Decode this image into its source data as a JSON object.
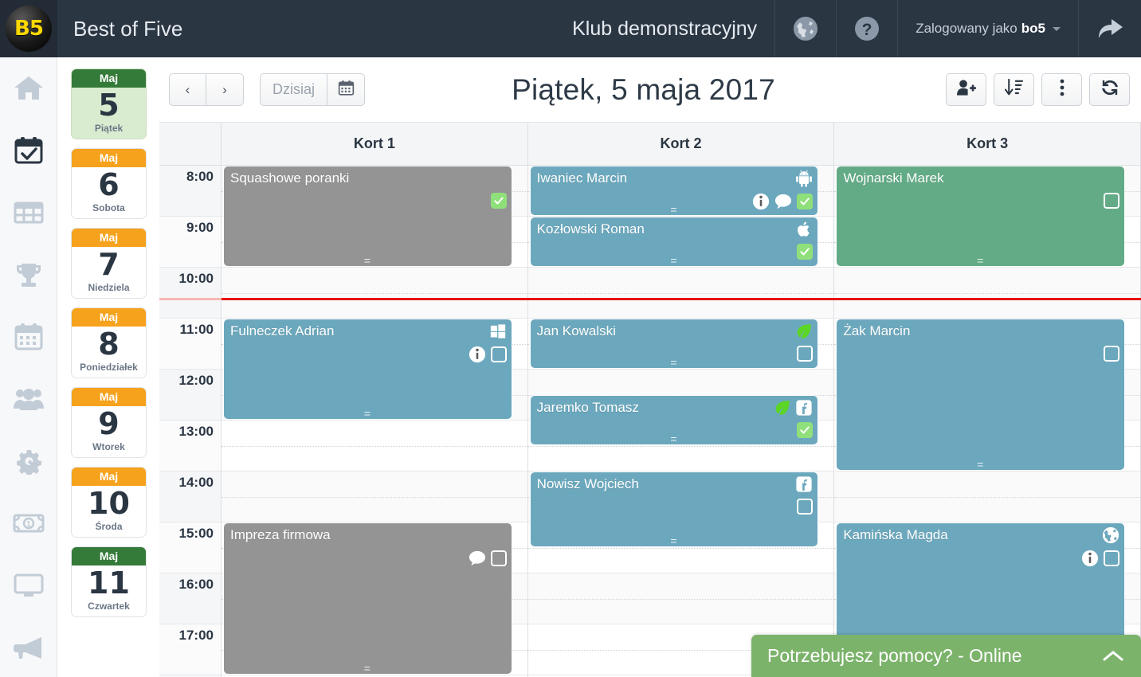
{
  "topbar": {
    "logo_text": "B5",
    "app_title": "Best of Five",
    "club_name": "Klub demonstracyjny",
    "language_icon": "globe-icon",
    "help_icon": "question-circle-icon",
    "user_prefix": "Zalogowany jako",
    "user_name": "bo5",
    "logout_icon": "share-arrow-icon",
    "bg_color": "#2b3643"
  },
  "rail": {
    "items": [
      {
        "name": "home-icon",
        "active": false
      },
      {
        "name": "calendar-check-icon",
        "active": true
      },
      {
        "name": "table-grid-icon",
        "active": false
      },
      {
        "name": "trophy-icon",
        "active": false
      },
      {
        "name": "calendar-icon",
        "active": false
      },
      {
        "name": "users-icon",
        "active": false
      },
      {
        "name": "cogs-icon",
        "active": false
      },
      {
        "name": "money-icon",
        "active": false
      },
      {
        "name": "desktop-icon",
        "active": false
      },
      {
        "name": "megaphone-icon",
        "active": false
      }
    ]
  },
  "daystrip": {
    "days": [
      {
        "month": "Maj",
        "day": "5",
        "weekday": "Piątek",
        "selected": true,
        "header_color": "green"
      },
      {
        "month": "Maj",
        "day": "6",
        "weekday": "Sobota",
        "selected": false,
        "header_color": "orange"
      },
      {
        "month": "Maj",
        "day": "7",
        "weekday": "Niedziela",
        "selected": false,
        "header_color": "orange"
      },
      {
        "month": "Maj",
        "day": "8",
        "weekday": "Poniedziałek",
        "selected": false,
        "header_color": "orange"
      },
      {
        "month": "Maj",
        "day": "9",
        "weekday": "Wtorek",
        "selected": false,
        "header_color": "orange"
      },
      {
        "month": "Maj",
        "day": "10",
        "weekday": "Środa",
        "selected": false,
        "header_color": "orange"
      },
      {
        "month": "Maj",
        "day": "11",
        "weekday": "Czwartek",
        "selected": false,
        "header_color": "green"
      }
    ],
    "colors": {
      "orange": "#f6a21d",
      "green": "#347a38",
      "selected_bg": "#d9ecd0"
    }
  },
  "toolbar": {
    "prev_label": "‹",
    "next_label": "›",
    "today_label": "Dzisiaj",
    "datepicker_icon": "calendar-icon",
    "page_title": "Piątek, 5 maja 2017",
    "right_buttons": [
      {
        "name": "add-user-button",
        "icon": "user-plus-icon"
      },
      {
        "name": "sort-button",
        "icon": "sort-amount-desc-icon"
      },
      {
        "name": "more-button",
        "icon": "ellipsis-vertical-icon"
      },
      {
        "name": "refresh-button",
        "icon": "refresh-icon"
      }
    ]
  },
  "calendar": {
    "columns": [
      "Kort 1",
      "Kort 2",
      "Kort 3"
    ],
    "hours": [
      "8:00",
      "9:00",
      "10:00",
      "11:00",
      "12:00",
      "13:00",
      "14:00",
      "15:00",
      "16:00",
      "17:00"
    ],
    "now_marker_hour": 10.6,
    "colors": {
      "blue": "#6ca8bd",
      "green": "#63ab86",
      "gray": "#949494",
      "now_line": "#e8120d",
      "checkbox_done": "#8fe07a"
    },
    "events": [
      {
        "court": 0,
        "title": "Squashowe poranki",
        "start": "8:00",
        "end": "10:00",
        "color": "gray",
        "badges": [],
        "icons": [
          "check-done-icon"
        ]
      },
      {
        "court": 0,
        "title": "Fulneczek Adrian",
        "start": "11:00",
        "end": "13:00",
        "color": "blue",
        "badges": [
          "windows-icon"
        ],
        "icons": [
          "info-circle-icon",
          "check-empty-icon"
        ]
      },
      {
        "court": 0,
        "title": "Impreza firmowa",
        "start": "15:00",
        "end": "18:00",
        "color": "gray",
        "badges": [],
        "icons": [
          "comment-icon",
          "check-empty-icon"
        ]
      },
      {
        "court": 1,
        "title": "Iwaniec Marcin",
        "start": "8:00",
        "end": "9:00",
        "color": "blue",
        "badges": [
          "android-icon"
        ],
        "icons": [
          "info-circle-icon",
          "comment-icon",
          "check-done-icon"
        ]
      },
      {
        "court": 1,
        "title": "Kozłowski Roman",
        "start": "9:00",
        "end": "10:00",
        "color": "blue",
        "badges": [
          "apple-icon"
        ],
        "icons": [
          "check-done-icon"
        ]
      },
      {
        "court": 1,
        "title": "Jan Kowalski",
        "start": "11:00",
        "end": "12:00",
        "color": "blue",
        "badges": [
          "leaf-icon"
        ],
        "icons": [
          "check-empty-icon"
        ]
      },
      {
        "court": 1,
        "title": "Jaremko Tomasz",
        "start": "12:30",
        "end": "13:30",
        "color": "blue",
        "badges": [
          "leaf-icon",
          "facebook-icon"
        ],
        "icons": [
          "check-done-icon"
        ]
      },
      {
        "court": 1,
        "title": "Nowisz Wojciech",
        "start": "14:00",
        "end": "15:30",
        "color": "blue",
        "badges": [
          "facebook-icon"
        ],
        "icons": [
          "check-empty-icon"
        ]
      },
      {
        "court": 2,
        "title": "Wojnarski Marek",
        "start": "8:00",
        "end": "10:00",
        "color": "green",
        "badges": [],
        "icons": [
          "check-empty-icon"
        ]
      },
      {
        "court": 2,
        "title": "Żak Marcin",
        "start": "11:00",
        "end": "14:00",
        "color": "blue",
        "badges": [],
        "icons": [
          "check-empty-icon"
        ]
      },
      {
        "court": 2,
        "title": "Kamińska Magda",
        "start": "15:00",
        "end": "18:00",
        "color": "blue",
        "badges": [
          "globe-icon"
        ],
        "icons": [
          "info-circle-icon",
          "check-empty-icon"
        ]
      }
    ]
  },
  "chat": {
    "label": "Potrzebujesz pomocy? - Online",
    "caret_icon": "chevron-up-icon",
    "bg_color": "#7cb36b"
  }
}
